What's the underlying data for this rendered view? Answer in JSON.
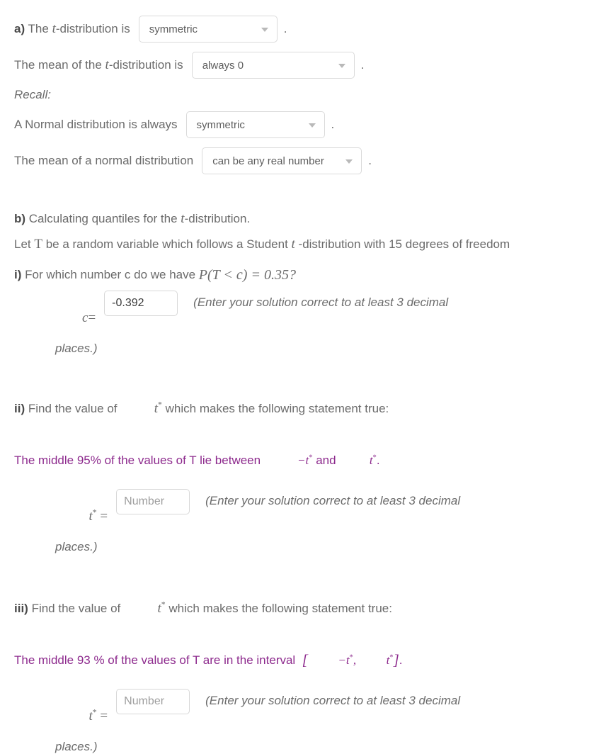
{
  "part_a": {
    "label": "a)",
    "q1_pre": " The ",
    "q1_math": "t",
    "q1_post": "-distribution is",
    "q1_select_value": "symmetric",
    "q2_pre": "The mean of the ",
    "q2_math": "t",
    "q2_post": "-distribution is",
    "q2_select_value": "always 0",
    "recall": "Recall:",
    "q3_text": "A Normal distribution is always",
    "q3_select_value": "symmetric",
    "q4_text": "The mean of a normal distribution",
    "q4_select_value": "can be any real number",
    "period": "."
  },
  "part_b": {
    "label": "b)",
    "heading_pre": " Calculating quantiles for the ",
    "heading_math": "t",
    "heading_post": "-distribution.",
    "setup_pre": "Let ",
    "setup_math": "T",
    "setup_post": " be a random variable which follows a Student ",
    "setup_math2": "t",
    "setup_post2": "-distribution with 15 degrees of freedom"
  },
  "part_i": {
    "label": "i)",
    "question_pre": " For which number c do we have ",
    "question_math": "P(T < c) = 0.35?",
    "answer_label_var": "c",
    "answer_label_eq": "=",
    "input_value": "-0.392",
    "note_line1": "(Enter your solution correct to at least 3 decimal",
    "note_line2": "places.)"
  },
  "part_ii": {
    "label": "ii)",
    "question_pre": " Find the value of ",
    "question_math": "t",
    "question_math_sup": "*",
    "question_post": " which makes the following statement true:",
    "statement_pre": "The middle 95% of the values of T lie between  ",
    "statement_math_neg": "−t",
    "statement_math_sup": "*",
    "statement_mid": " and ",
    "statement_math2": "t",
    "statement_math2_sup": "*",
    "statement_end": ".",
    "answer_label_var": "t",
    "answer_label_sup": "*",
    "answer_label_eq": "=",
    "input_placeholder": "Number",
    "note_line1": "(Enter your solution correct to at least 3 decimal",
    "note_line2": "places.)"
  },
  "part_iii": {
    "label": "iii)",
    "question_pre": " Find the value of ",
    "question_math": "t",
    "question_math_sup": "*",
    "question_post": " which makes the following statement true:",
    "statement_pre": "The middle 93 % of the values of T are in the interval  ",
    "statement_bracket_open": "[",
    "statement_math_neg": "−t",
    "statement_math_sup": "*",
    "statement_comma": ",",
    "statement_math2": "t",
    "statement_math2_sup": "*",
    "statement_bracket_close": "]",
    "statement_end": ".",
    "answer_label_var": "t",
    "answer_label_sup": "*",
    "answer_label_eq": "=",
    "input_placeholder": "Number",
    "note_line1": "(Enter your solution correct to at least 3 decimal",
    "note_line2": "places.)"
  },
  "theme": {
    "body_text": "#6b6b6b",
    "accent_purple": "#8d2a8d",
    "border": "#dadada"
  }
}
